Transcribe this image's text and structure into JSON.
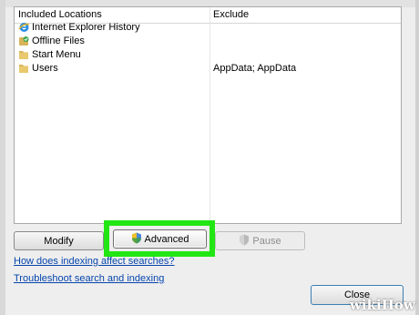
{
  "table": {
    "headers": {
      "included": "Included Locations",
      "exclude": "Exclude"
    },
    "rows": [
      {
        "name": "Internet Explorer History",
        "icon": "internet-explorer-icon",
        "exclude": ""
      },
      {
        "name": "Offline Files",
        "icon": "offline-files-icon",
        "exclude": ""
      },
      {
        "name": "Start Menu",
        "icon": "folder-icon",
        "exclude": ""
      },
      {
        "name": "Users",
        "icon": "folder-icon",
        "exclude": "AppData; AppData"
      }
    ]
  },
  "buttons": {
    "modify": "Modify",
    "advanced": "Advanced",
    "pause": "Pause",
    "close": "Close"
  },
  "links": {
    "how_indexing": "How does indexing affect searches?",
    "troubleshoot": "Troubleshoot search and indexing"
  },
  "highlight_color": "#22e613",
  "watermark": "wikiHow"
}
